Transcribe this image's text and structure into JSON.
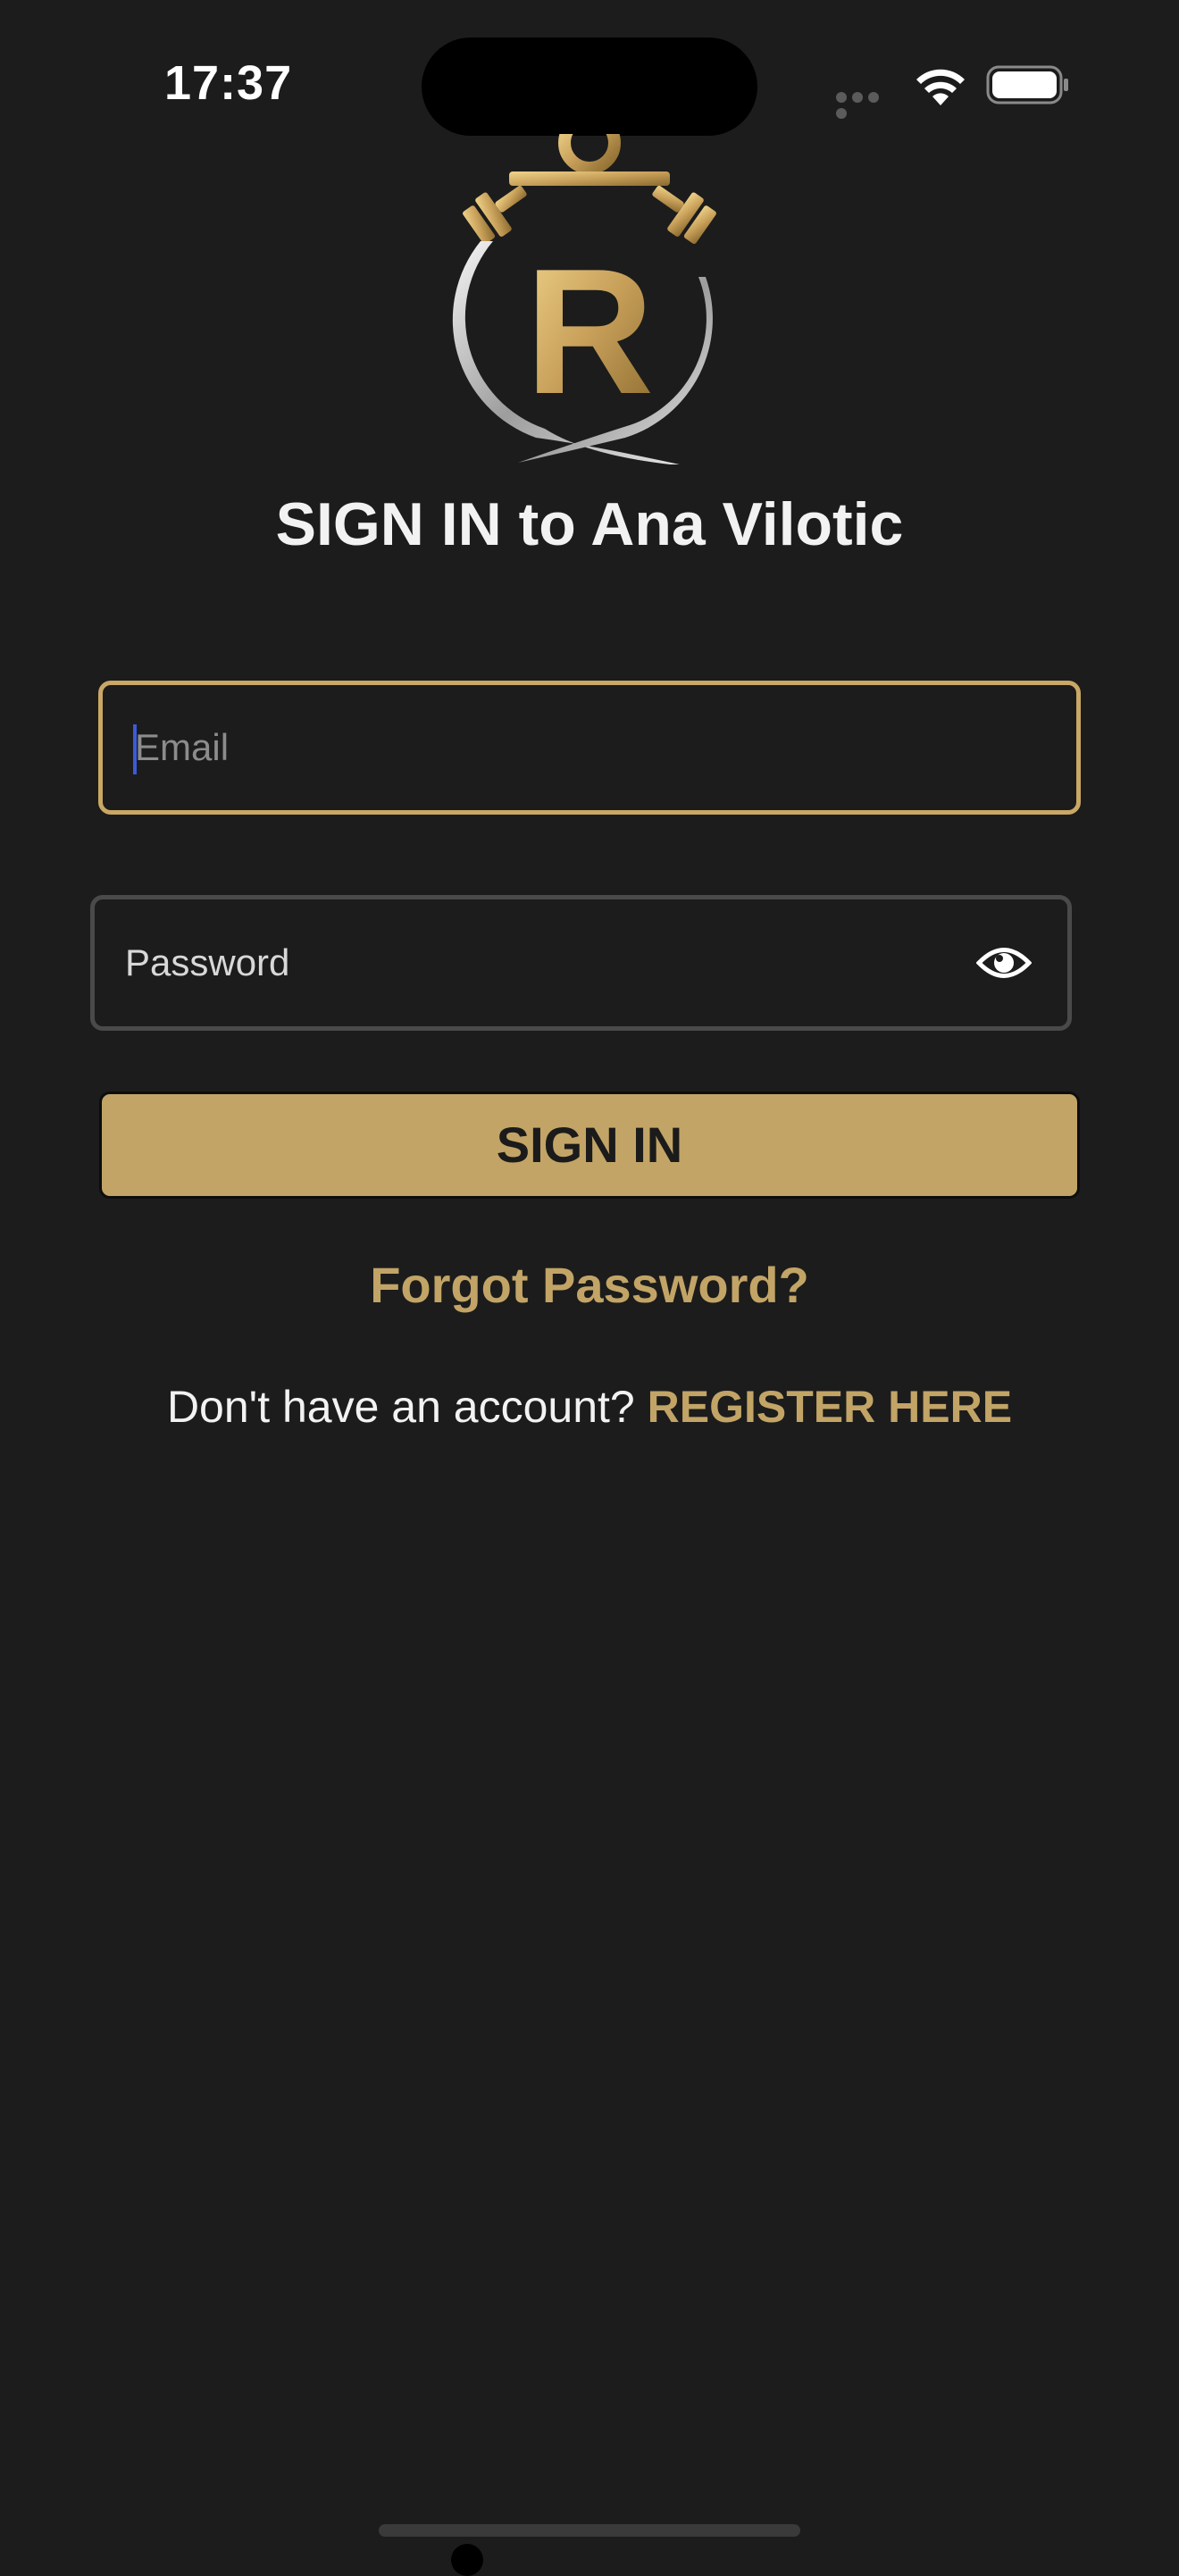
{
  "status_bar": {
    "time": "17:37"
  },
  "logo": {
    "letter": "R",
    "icon": "stopwatch-dumbbell-logo"
  },
  "header": {
    "title": "SIGN IN to Ana Vilotic"
  },
  "form": {
    "email_placeholder": "Email",
    "email_value": "",
    "password_placeholder": "Password",
    "password_value": "",
    "password_toggle_icon": "eye-icon",
    "submit_label": "SIGN IN",
    "forgot_label": "Forgot Password?",
    "register_prompt": "Don't have an account?",
    "register_link": "REGISTER HERE"
  },
  "colors": {
    "background": "#1c1c1c",
    "accent_gold": "#c2a466",
    "focus_border": "#c9a865",
    "inactive_border": "#4a4a4a",
    "text": "#f2f2f2"
  }
}
